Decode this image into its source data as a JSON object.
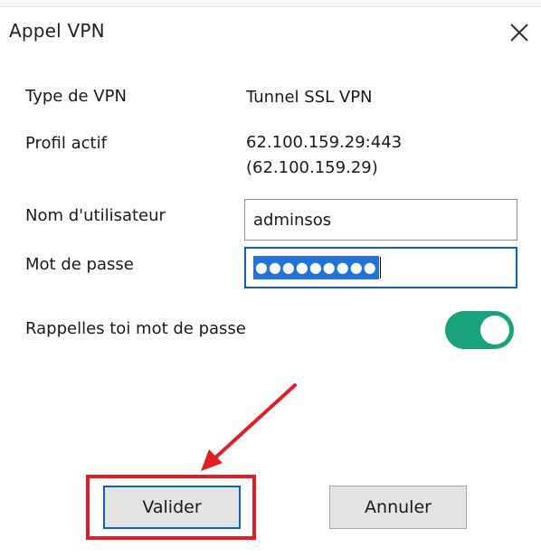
{
  "dialog": {
    "title": "Appel VPN",
    "close_icon": "close-icon"
  },
  "info": {
    "vpn_type_label": "Type de VPN",
    "vpn_type_value": "Tunnel SSL VPN",
    "profile_label": "Profil actif",
    "profile_value_line1": "62.100.159.29:443",
    "profile_value_line2": "(62.100.159.29)"
  },
  "form": {
    "username_label": "Nom d'utilisateur",
    "username_value": "adminsos",
    "password_label": "Mot de passe",
    "password_mask": "●●●●●●●●●",
    "remember_label": "Rappelles toi mot de passe",
    "remember_enabled": true
  },
  "buttons": {
    "validate_label": "Valider",
    "cancel_label": "Annuler"
  },
  "colors": {
    "accent_blue": "#0a62c7",
    "toggle_green": "#1aa37a",
    "annotation_red": "#e21d24"
  }
}
